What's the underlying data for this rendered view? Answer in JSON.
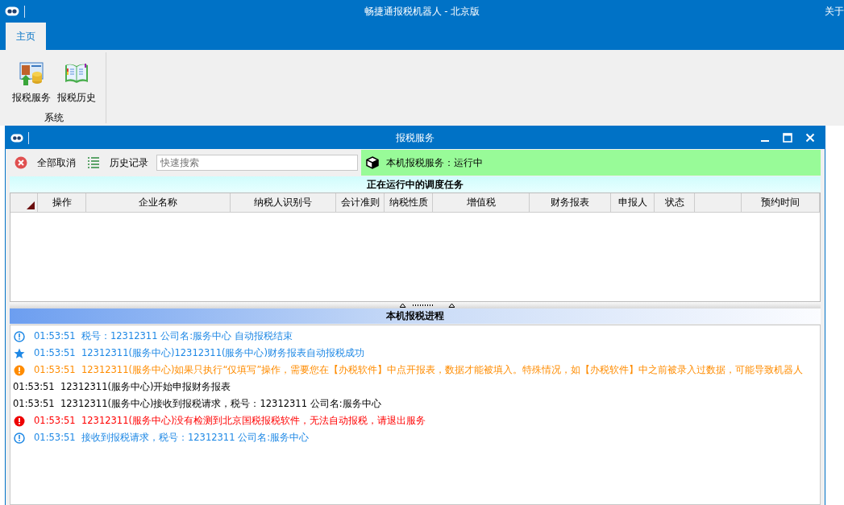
{
  "app_window": {
    "title": "畅捷通报税机器人 - 北京版",
    "about_link": "关于"
  },
  "ribbon": {
    "tabs": [
      {
        "label": "主页",
        "selected": true
      }
    ],
    "groups": [
      {
        "label": "系统",
        "buttons": [
          {
            "label": "报税服务",
            "kind": "service"
          },
          {
            "label": "报税历史",
            "kind": "history"
          }
        ]
      }
    ]
  },
  "service_window": {
    "title": "报税服务",
    "toolbar": {
      "cancel_all": "全部取消",
      "history": "历史记录",
      "search": {
        "placeholder": "快速搜索"
      },
      "status": "本机报税服务：运行中"
    },
    "tasks": {
      "title": "正在运行中的调度任务",
      "columns": [
        "操作",
        "企业名称",
        "纳税人识别号",
        "会计准则",
        "纳税性质",
        "增值税",
        "财务报表",
        "申报人",
        "状态",
        "",
        "预约时间"
      ]
    },
    "progress": {
      "title": "本机报税进程",
      "log": [
        {
          "kind": "info",
          "time": "01:53:51",
          "text": "税号：12312311 公司名:服务中心 自动报税结束"
        },
        {
          "kind": "success",
          "time": "01:53:51",
          "text": "12312311(服务中心)12312311(服务中心)财务报表自动报税成功"
        },
        {
          "kind": "warning",
          "time": "01:53:51",
          "text": "12312311(服务中心)如果只执行“仅填写”操作，需要您在【办税软件】中点开报表，数据才能被填入。特殊情况，如【办税软件】中之前被录入过数据，可能导致机器人"
        },
        {
          "kind": "plain",
          "time": "01:53:51",
          "text": "12312311(服务中心)开始申报财务报表"
        },
        {
          "kind": "plain",
          "time": "01:53:51",
          "text": "12312311(服务中心)接收到报税请求，税号：12312311 公司名:服务中心"
        },
        {
          "kind": "error",
          "time": "01:53:51",
          "text": "12312311(服务中心)没有检测到北京国税报税软件，无法自动报税，请退出服务"
        },
        {
          "kind": "info",
          "time": "01:53:51",
          "text": "接收到报税请求，税号：12312311 公司名:服务中心"
        }
      ]
    }
  }
}
